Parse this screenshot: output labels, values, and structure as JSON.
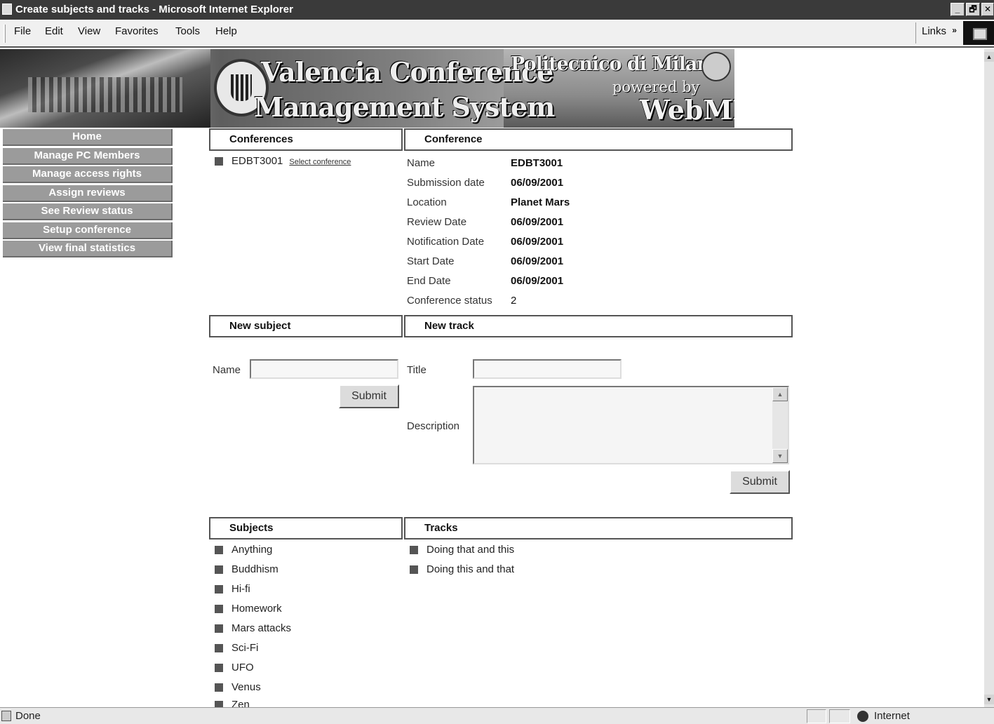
{
  "window": {
    "title": "Create subjects and tracks - Microsoft Internet Explorer",
    "controls": [
      "_",
      "🗗",
      "✕"
    ]
  },
  "menubar": {
    "items": [
      "File",
      "Edit",
      "View",
      "Favorites",
      "Tools",
      "Help"
    ],
    "links_label": "Links",
    "links_chevron": "»"
  },
  "banner": {
    "title_line1": "Valencia Conference",
    "title_line2": "Management System",
    "partner": "Politecnico di Milano",
    "powered_by": "powered by",
    "powered_name": "WebML"
  },
  "nav": {
    "items": [
      "Home",
      "Manage PC Members",
      "Manage access rights",
      "Assign reviews",
      "See Review status",
      "Setup conference",
      "View final statistics"
    ]
  },
  "conferences": {
    "header": "Conferences",
    "items": [
      {
        "name": "EDBT3001",
        "action": "Select conference"
      }
    ]
  },
  "conference": {
    "header": "Conference",
    "fields": [
      {
        "label": "Name",
        "value": "EDBT3001"
      },
      {
        "label": "Submission date",
        "value": "06/09/2001"
      },
      {
        "label": "Location",
        "value": "Planet Mars"
      },
      {
        "label": "Review Date",
        "value": "06/09/2001"
      },
      {
        "label": "Notification Date",
        "value": "06/09/2001"
      },
      {
        "label": "Start Date",
        "value": "06/09/2001"
      },
      {
        "label": "End Date",
        "value": "06/09/2001"
      },
      {
        "label": "Conference status",
        "value": "2"
      }
    ]
  },
  "new_subject": {
    "header": "New subject",
    "name_label": "Name",
    "name_value": "",
    "submit_label": "Submit"
  },
  "new_track": {
    "header": "New track",
    "title_label": "Title",
    "title_value": "",
    "description_label": "Description",
    "description_value": "",
    "submit_label": "Submit"
  },
  "subjects": {
    "header": "Subjects",
    "items": [
      "Anything",
      "Buddhism",
      "Hi-fi",
      "Homework",
      "Mars attacks",
      "Sci-Fi",
      "UFO",
      "Venus",
      "Zen"
    ]
  },
  "tracks": {
    "header": "Tracks",
    "items": [
      "Doing that and this",
      "Doing this and that"
    ]
  },
  "statusbar": {
    "status": "Done",
    "zone": "Internet"
  }
}
